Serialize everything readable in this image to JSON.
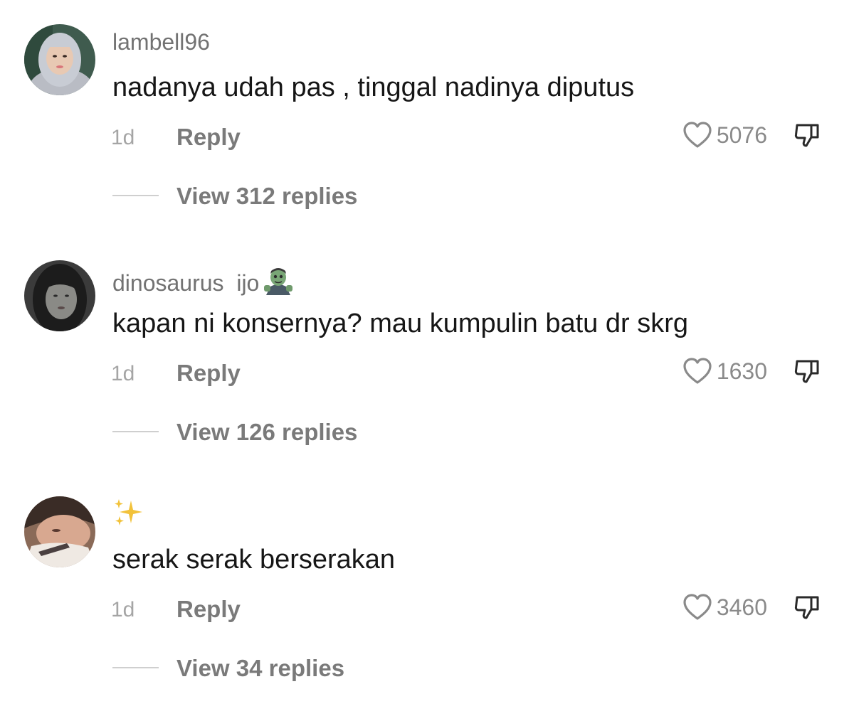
{
  "comments": [
    {
      "username": "lambell96",
      "text": "nadanya udah pas , tinggal nadinya diputus",
      "time": "1d",
      "reply_label": "Reply",
      "likes": "5076",
      "view_replies": "View 312 replies"
    },
    {
      "username": "dinosaurus  ijo",
      "username_emoji": "zombie-emoji",
      "text": "kapan ni konsernya? mau kumpulin batu dr skrg",
      "time": "1d",
      "reply_label": "Reply",
      "likes": "1630",
      "view_replies": "View 126 replies"
    },
    {
      "username_emoji": "sparkles-emoji",
      "text": "serak serak berserakan",
      "time": "1d",
      "reply_label": "Reply",
      "likes": "3460",
      "view_replies": "View 34 replies"
    }
  ],
  "icons": {
    "like": "heart-outline-icon",
    "dislike": "thumbs-down-outline-icon"
  },
  "colors": {
    "username": "#727272",
    "meta": "#a5a5a5",
    "action": "#7a7a7a",
    "text": "#161616"
  }
}
